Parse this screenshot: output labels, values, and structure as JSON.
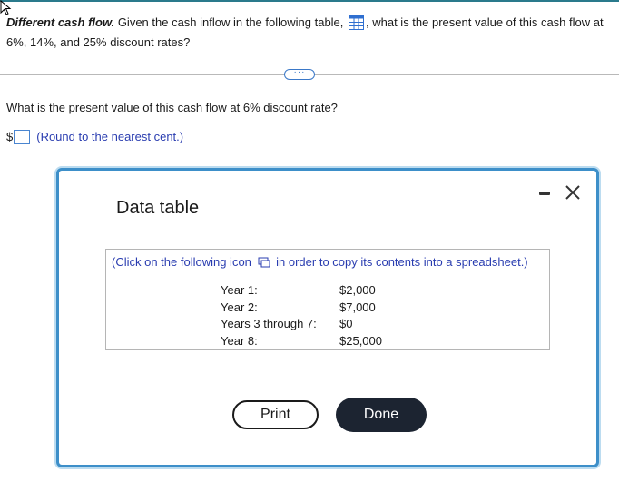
{
  "question": {
    "title": "Different cash flow.",
    "text_before_icon": " Given the cash inflow in the following table, ",
    "text_after_icon": ", what is the present value of this cash flow at 6%, 14%, and 25% discount rates?"
  },
  "expand_button_label": "···",
  "sub_question": "What is the present value of this cash flow at 6% discount rate?",
  "answer": {
    "currency": "$",
    "value": "",
    "hint": "(Round to the nearest cent.)"
  },
  "modal": {
    "title": "Data table",
    "copy_before": "(Click on the following icon ",
    "copy_after": " in order to copy its contents into a spreadsheet.)",
    "rows": [
      {
        "label": "Year 1:",
        "value": "$2,000"
      },
      {
        "label": "Year 2:",
        "value": "$7,000"
      },
      {
        "label": "Years 3 through 7:",
        "value": "$0"
      },
      {
        "label": "Year 8:",
        "value": "$25,000"
      }
    ],
    "print_label": "Print",
    "done_label": "Done"
  },
  "colors": {
    "accent_blue": "#3d8fc9",
    "hint_text": "#2a3db0",
    "done_button": "#1c2431"
  }
}
